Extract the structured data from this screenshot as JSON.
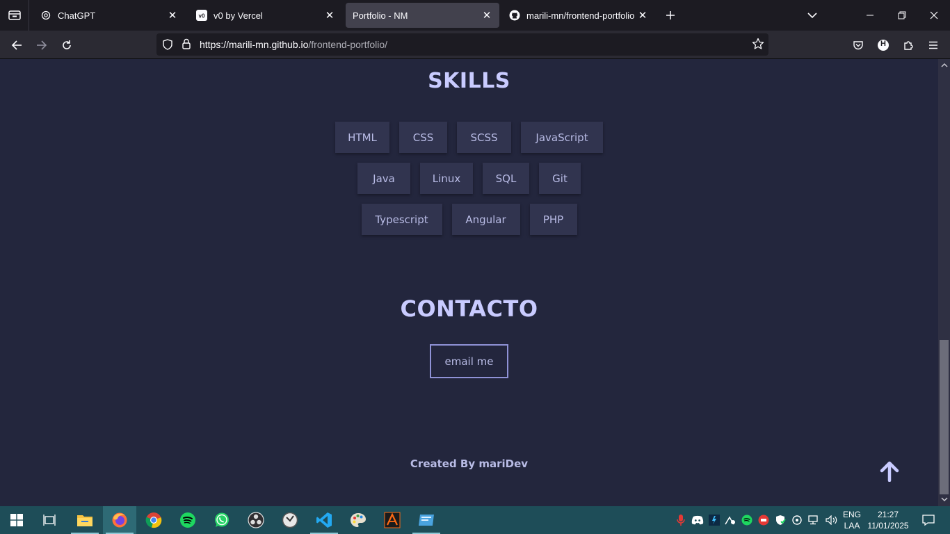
{
  "browser": {
    "tabs": [
      {
        "title": "ChatGPT",
        "icon": "chatgpt-icon",
        "active": false
      },
      {
        "title": "v0 by Vercel",
        "icon": "v0-icon",
        "active": false
      },
      {
        "title": "Portfolio - NM",
        "icon": "none",
        "active": true
      },
      {
        "title": "marili-mn/frontend-portfolio",
        "icon": "github-icon",
        "active": false
      }
    ],
    "url_host": "https://marili-mn.github.io",
    "url_path": "/frontend-portfolio/",
    "profile_initial": "H"
  },
  "page": {
    "skills_title": "SKILLS",
    "skills_rows": [
      [
        "HTML",
        "CSS",
        "SCSS",
        "JavaScript"
      ],
      [
        "Java",
        "Linux",
        "SQL",
        "Git"
      ],
      [
        "Typescript",
        "Angular",
        "PHP"
      ]
    ],
    "contact_title": "CONTACTO",
    "email_label": "email me",
    "footer_text": "Created By mariDev"
  },
  "taskbar": {
    "apps": [
      "start-icon",
      "task-view-icon",
      "file-explorer-icon",
      "firefox-icon",
      "chrome-icon",
      "spotify-icon",
      "whatsapp-icon",
      "obs-icon",
      "clock-app-icon",
      "vscode-icon",
      "paint-icon",
      "autocad-icon",
      "remote-desktop-icon"
    ],
    "language_line1": "ENG",
    "language_line2": "LAA",
    "time": "21:27",
    "date": "11/01/2025"
  },
  "colors": {
    "page_bg": "#23263d",
    "heading": "#c9cbff",
    "chip_bg": "#31344f",
    "accent_border": "#8f92d6",
    "taskbar_bg": "#1e4d58"
  }
}
